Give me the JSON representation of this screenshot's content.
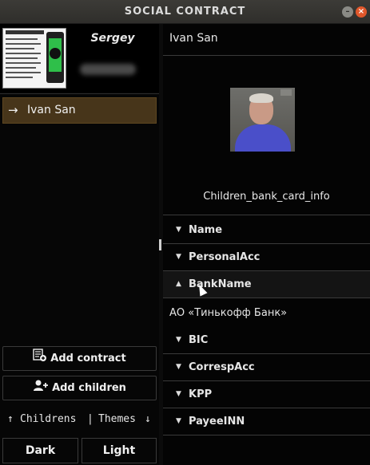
{
  "window": {
    "title": "SOCIAL CONTRACT",
    "min_glyph": "–",
    "close_glyph": "×"
  },
  "profile": {
    "name": "Sergey"
  },
  "contacts": [
    {
      "arrow": "→",
      "name": "Ivan San"
    }
  ],
  "buttons": {
    "add_contract": "Add contract",
    "add_children": "Add children",
    "dark": "Dark",
    "light": "Light"
  },
  "toggle": {
    "up": "↑",
    "childrens": "Childrens",
    "sep": "|",
    "themes": "Themes",
    "down": "↓"
  },
  "detail": {
    "title": "Ivan San",
    "caption": "Children_bank_card_info",
    "fields": [
      {
        "label": "Name",
        "expanded": false
      },
      {
        "label": "PersonalAcc",
        "expanded": false
      },
      {
        "label": "BankName",
        "expanded": true,
        "value": "АО «Тинькофф Банк»"
      },
      {
        "label": "BIC",
        "expanded": false
      },
      {
        "label": "CorrespAcc",
        "expanded": false
      },
      {
        "label": "KPP",
        "expanded": false
      },
      {
        "label": "PayeeINN",
        "expanded": false
      }
    ],
    "collapsed_glyph": "▼",
    "expanded_glyph": "▲"
  },
  "colors": {
    "selected_row": "#47351a",
    "close_button": "#e0572b",
    "photo_shirt": "#4a4fc9"
  }
}
